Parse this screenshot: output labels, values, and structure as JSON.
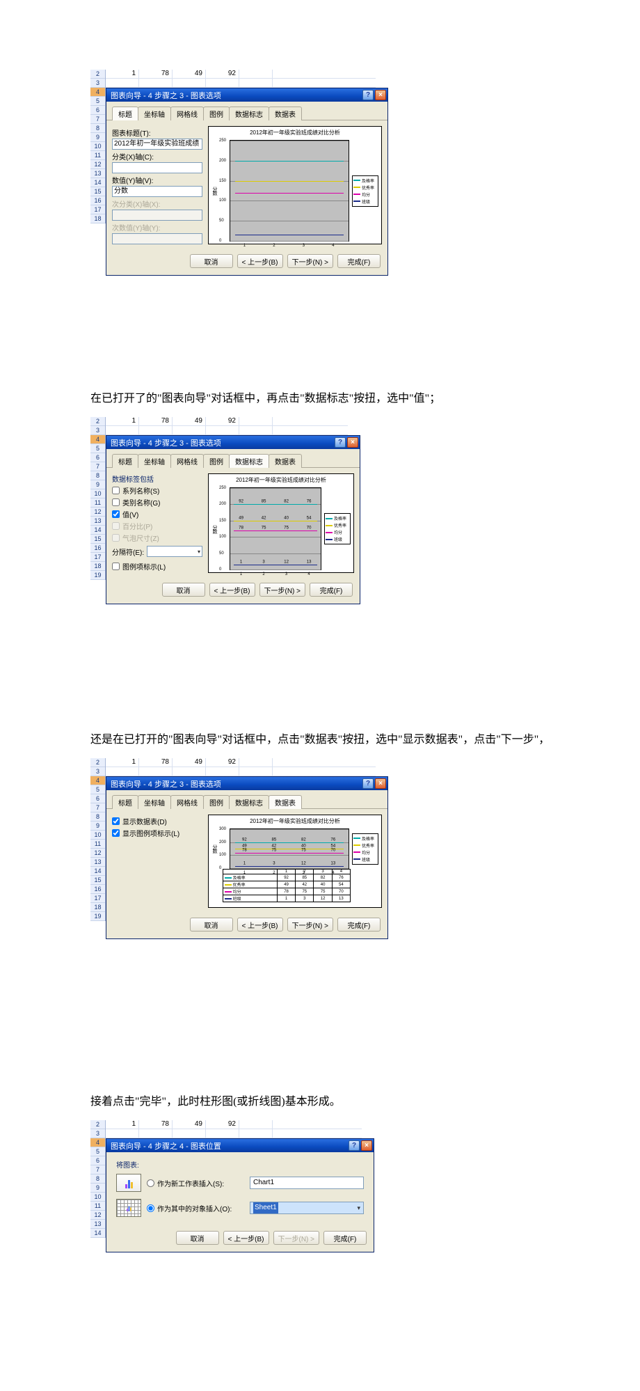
{
  "spreadsheet": {
    "rows_2_3": [
      {
        "n": "2",
        "cells": [
          "1",
          "78",
          "49",
          "92",
          ""
        ]
      },
      {
        "n": "3",
        "cells": [
          "",
          "",
          "",
          "",
          ""
        ]
      }
    ],
    "row_numbers_tall": [
      "2",
      "3",
      "4",
      "5",
      "6",
      "7",
      "8",
      "9",
      "10",
      "11",
      "12",
      "13",
      "14",
      "15",
      "16",
      "17",
      "18"
    ],
    "row_numbers_short": [
      "2",
      "3",
      "4",
      "5",
      "6",
      "7",
      "8",
      "9",
      "10",
      "11",
      "12",
      "13",
      "14",
      "15",
      "16",
      "17",
      "18",
      "19"
    ],
    "row_numbers_final": [
      "2",
      "3",
      "4",
      "5",
      "6",
      "7",
      "8",
      "9",
      "10",
      "11",
      "12",
      "13",
      "14"
    ]
  },
  "wizard3_title": "图表向导 - 4 步骤之 3 - 图表选项",
  "wizard4_title": "图表向导 - 4 步骤之 4 - 图表位置",
  "tabs": [
    "标题",
    "坐标轴",
    "网格线",
    "图例",
    "数据标志",
    "数据表"
  ],
  "btns": {
    "cancel": "取消",
    "back": "< 上一步(B)",
    "next": "下一步(N) >",
    "finish": "完成(F)"
  },
  "chart": {
    "title": "2012年初一年级实验班成绩对比分析",
    "yaxis": "分数",
    "legend": [
      "及格率",
      "优秀率",
      "均分",
      "班级"
    ],
    "xticks": [
      "1",
      "2",
      "3",
      "4"
    ],
    "yticks_250": [
      "0",
      "50",
      "100",
      "150",
      "200",
      "250"
    ],
    "yticks_300": [
      "0",
      "100",
      "200",
      "300"
    ]
  },
  "dlg1": {
    "active_tab": 0,
    "labels": {
      "chart_title": "图表标题(T):",
      "cat_axis": "分类(X)轴(C):",
      "val_axis": "数值(Y)轴(V):",
      "sec_cat": "次分类(X)轴(X):",
      "sec_val": "次数值(Y)轴(Y):"
    },
    "values": {
      "chart_title": "2012年初一年级实验班成绩",
      "val_axis": "分数"
    }
  },
  "dlg2": {
    "active_tab": 4,
    "group": "数据标签包括",
    "opts": {
      "series": "系列名称(S)",
      "category": "类别名称(G)",
      "value": "值(V)",
      "percent": "百分比(P)",
      "bubble": "气泡尺寸(Z)"
    },
    "separator_label": "分隔符(E):",
    "legend_key": "图例项标示(L)",
    "data_labels": {
      "s1": [
        "92",
        "85",
        "82",
        "76"
      ],
      "s2": [
        "49",
        "42",
        "40",
        "54"
      ],
      "s3": [
        "78",
        "75",
        "75",
        "70"
      ],
      "s4": [
        "1",
        "3",
        "12",
        "13"
      ]
    }
  },
  "dlg3": {
    "active_tab": 5,
    "opts": {
      "show_table": "显示数据表(D)",
      "show_legend_key": "显示图例项标示(L)"
    },
    "table": {
      "headers": [
        "",
        "1",
        "2",
        "3",
        "4"
      ],
      "rows": [
        {
          "name": "及格率",
          "vals": [
            "92",
            "85",
            "82",
            "76"
          ]
        },
        {
          "name": "优秀率",
          "vals": [
            "49",
            "42",
            "40",
            "54"
          ]
        },
        {
          "name": "均分",
          "vals": [
            "78",
            "75",
            "75",
            "70"
          ]
        },
        {
          "name": "班级",
          "vals": [
            "1",
            "3",
            "12",
            "13"
          ]
        }
      ]
    }
  },
  "dlg4": {
    "section": "将图表:",
    "opt_new_sheet": "作为新工作表插入(S):",
    "opt_object_in": "作为其中的对象插入(O):",
    "new_sheet_name": "Chart1",
    "object_sheet": "Sheet1"
  },
  "paragraphs": {
    "p1": "在已打开了的\"图表向导\"对话框中，再点击\"数据标志\"按扭，选中\"值\"；",
    "p2": "还是在已打开的\"图表向导\"对话框中，点击\"数据表\"按扭，选中\"显示数据表\"，点击\"下一步\"，",
    "p3": "接着点击\"完毕\"，此时柱形图(或折线图)基本形成。"
  }
}
